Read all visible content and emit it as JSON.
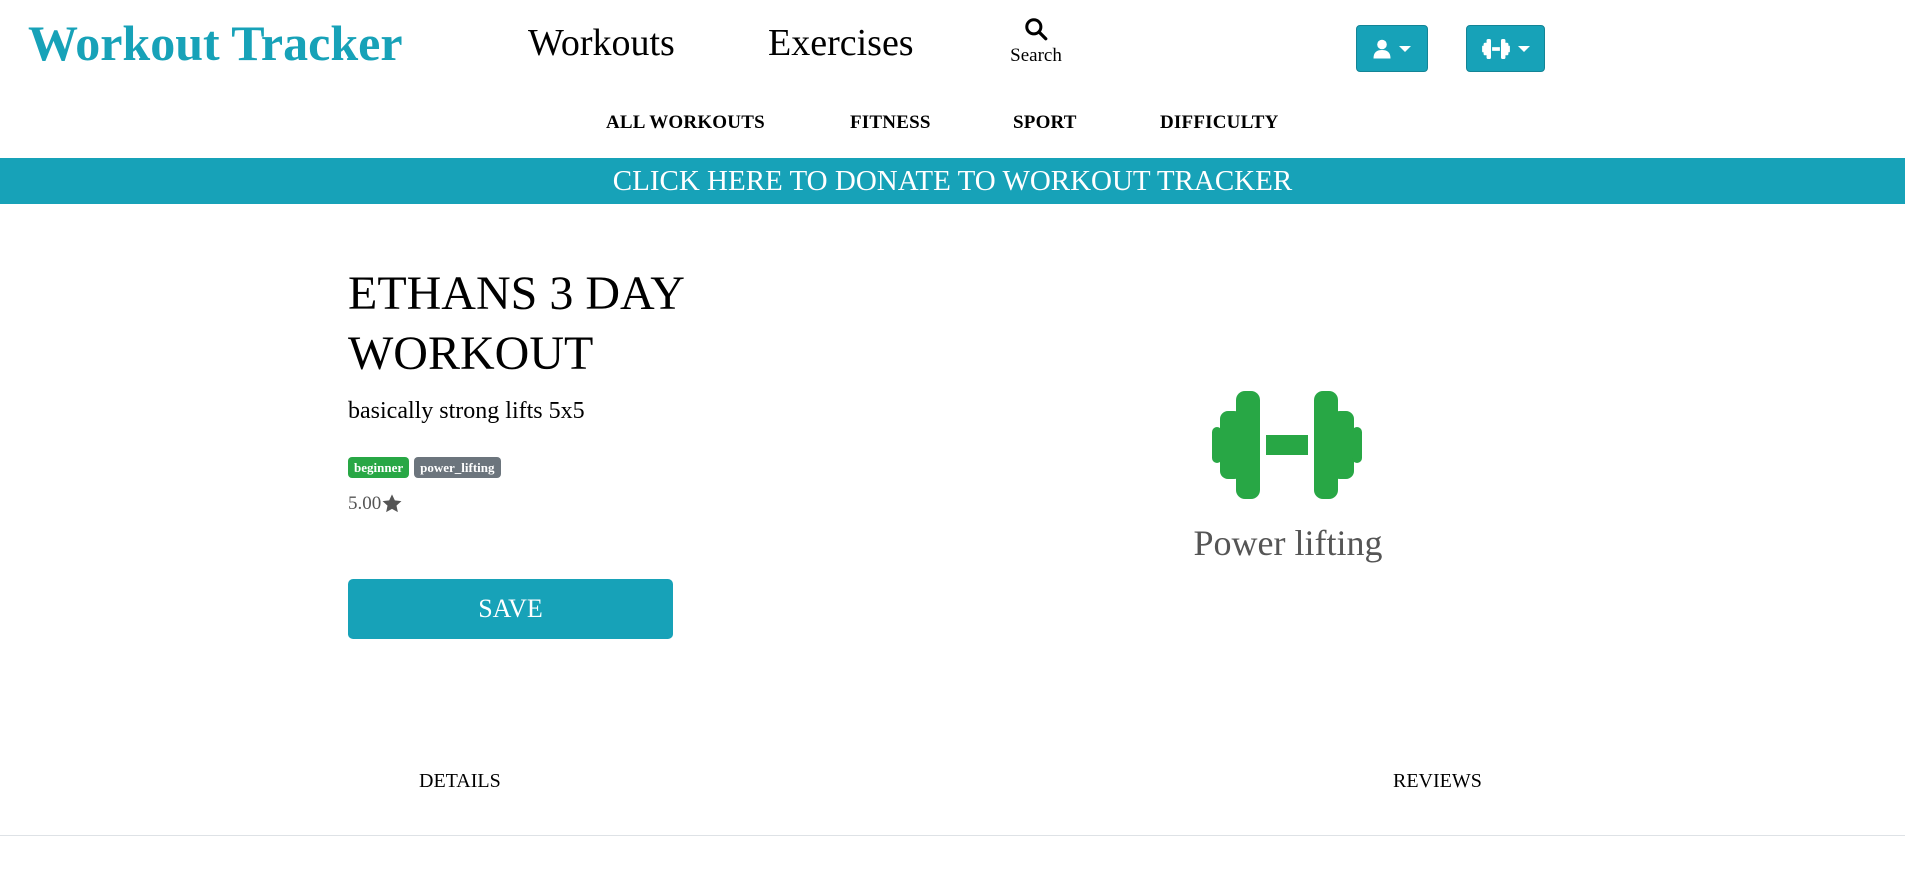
{
  "header": {
    "brand": "Workout Tracker",
    "nav": {
      "workouts": "Workouts",
      "exercises": "Exercises",
      "search": "Search"
    },
    "icons": {
      "search": "search-icon",
      "user_menu": "user-icon",
      "fitness_menu": "dumbbell-icon"
    }
  },
  "subnav": {
    "all_workouts": "ALL WORKOUTS",
    "fitness": "FITNESS",
    "sport": "SPORT",
    "difficulty": "DIFFICULTY"
  },
  "banner": {
    "donate": "CLICK HERE TO DONATE TO WORKOUT TRACKER"
  },
  "workout": {
    "title": "ETHANS 3 DAY WORKOUT",
    "description": "basically strong lifts 5x5",
    "tags": [
      {
        "label": "beginner",
        "color": "#28a745"
      },
      {
        "label": "power_lifting",
        "color": "#6c757d"
      }
    ],
    "rating": "5.00",
    "save_label": "SAVE",
    "category": {
      "icon": "dumbbell-icon",
      "label": "Power lifting",
      "color": "#28a745"
    }
  },
  "tabs": {
    "details": "DETAILS",
    "reviews": "REVIEWS"
  },
  "colors": {
    "accent": "#17a2b8",
    "success": "#28a745",
    "secondary": "#6c757d"
  }
}
